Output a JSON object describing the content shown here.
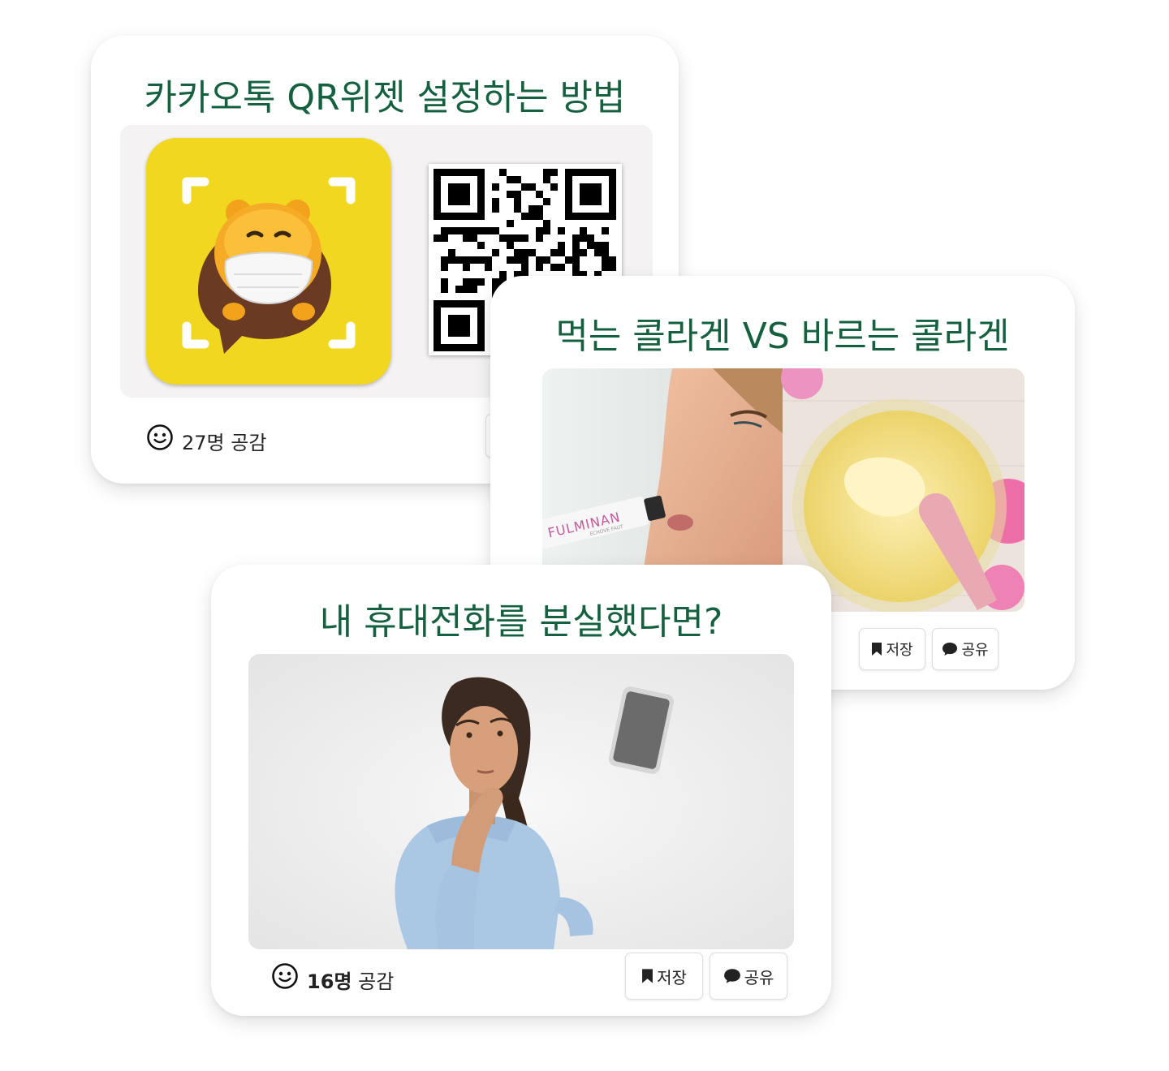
{
  "cards": [
    {
      "title": "카카오톡 QR위젯 설정하는 방법",
      "like_count": "27명",
      "like_label": "공감"
    },
    {
      "title": "먹는 콜라겐 VS 바르는 콜라겐",
      "photo_text": "FULMINAN",
      "photo_subtext": "ECHOVE FAUT",
      "save_label": "저장",
      "share_label": "공유"
    },
    {
      "title": "내 휴대전화를 분실했다면?",
      "like_count": "16명",
      "like_label": "공감",
      "save_label": "저장",
      "share_label": "공유"
    }
  ],
  "colors": {
    "title": "#15603f",
    "kakao_yellow": "#f1d71f",
    "background": "#ffffff"
  },
  "icons": {
    "like": "smiley-icon",
    "save": "bookmark-icon",
    "share": "speech-bubble-icon"
  }
}
